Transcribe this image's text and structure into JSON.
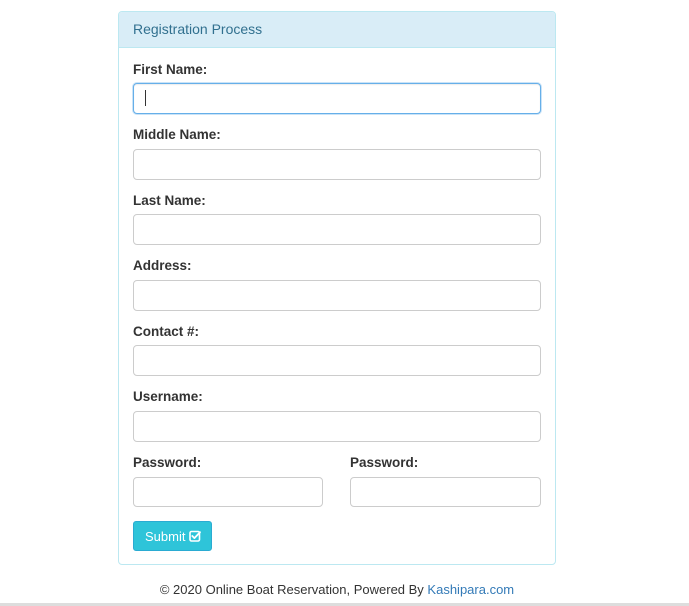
{
  "panel": {
    "title": "Registration Process"
  },
  "form": {
    "first_name_label": "First Name:",
    "first_name_value": "",
    "middle_name_label": "Middle Name:",
    "middle_name_value": "",
    "last_name_label": "Last Name:",
    "last_name_value": "",
    "address_label": "Address:",
    "address_value": "",
    "contact_label": "Contact #:",
    "contact_value": "",
    "username_label": "Username:",
    "username_value": "",
    "password_label": "Password:",
    "password_value": "",
    "confirm_password_label": "Password:",
    "confirm_password_value": "",
    "submit_label": "Submit",
    "submit_icon": "check-square-icon"
  },
  "footer": {
    "text": "© 2020 Online Boat Reservation, Powered By ",
    "link_text": "Kashipara.com"
  },
  "colors": {
    "panel_heading_bg": "#d9edf7",
    "panel_border": "#bce8f1",
    "heading_text": "#31708f",
    "submit_bg": "#2ec4d9",
    "link": "#337ab7",
    "focus_border": "#66afe9"
  }
}
